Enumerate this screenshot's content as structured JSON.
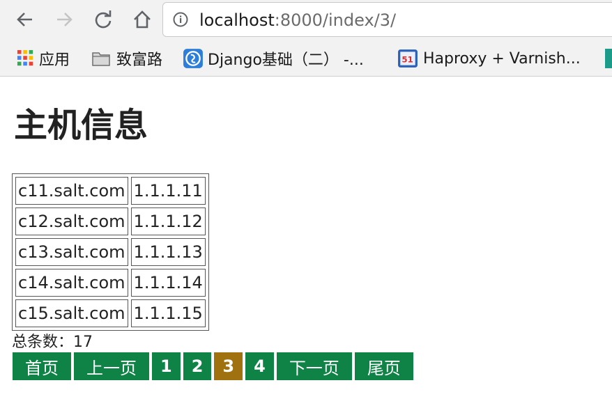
{
  "browser": {
    "url_host": "localhost",
    "url_path": ":8000/index/3/",
    "bookmarks": [
      {
        "label": "应用",
        "icon": "apps-grid-icon"
      },
      {
        "label": "致富路",
        "icon": "folder-icon"
      },
      {
        "label": "Django基础（二） -...",
        "icon": "django-site-icon"
      },
      {
        "label": "Haproxy + Varnish...",
        "icon": "haproxy-site-icon"
      }
    ]
  },
  "page": {
    "title": "主机信息",
    "hosts": [
      {
        "hostname": "c11.salt.com",
        "ip": "1.1.1.11"
      },
      {
        "hostname": "c12.salt.com",
        "ip": "1.1.1.12"
      },
      {
        "hostname": "c13.salt.com",
        "ip": "1.1.1.13"
      },
      {
        "hostname": "c14.salt.com",
        "ip": "1.1.1.14"
      },
      {
        "hostname": "c15.salt.com",
        "ip": "1.1.1.15"
      }
    ],
    "total_label": "总条数：",
    "total_count": "17",
    "pagination": {
      "first": "首页",
      "prev": "上一页",
      "pages": [
        "1",
        "2",
        "3",
        "4"
      ],
      "current_page": "3",
      "next": "下一页",
      "last": "尾页"
    }
  },
  "colors": {
    "pager_green": "#0f8246",
    "pager_active": "#a0720f"
  }
}
